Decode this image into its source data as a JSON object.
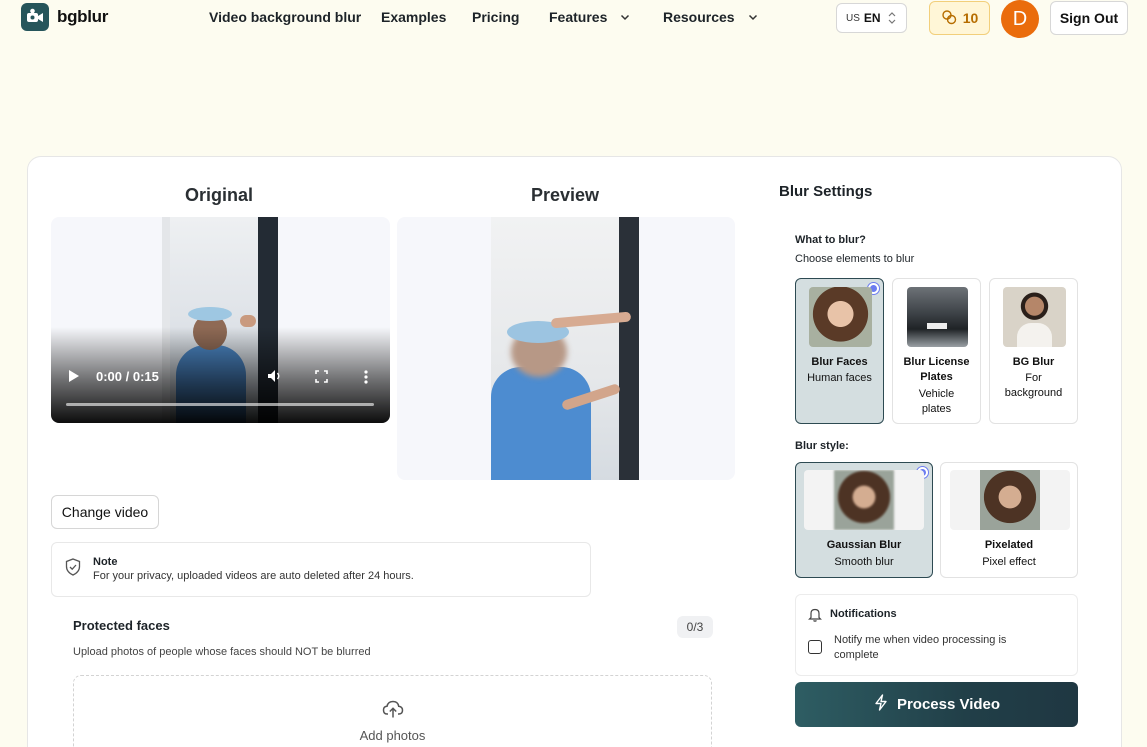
{
  "header": {
    "brand": "bgblur",
    "nav": [
      {
        "label": "Video background blur"
      },
      {
        "label": "Examples"
      },
      {
        "label": "Pricing"
      },
      {
        "label": "Features"
      },
      {
        "label": "Resources"
      }
    ],
    "lang_country": "US",
    "lang_code": "EN",
    "credits": "10",
    "avatar_letter": "D",
    "signout": "Sign Out"
  },
  "editor": {
    "original_title": "Original",
    "preview_title": "Preview",
    "player_time": "0:00 / 0:15",
    "change_video": "Change video",
    "note_title": "Note",
    "note_text": "For your privacy, uploaded videos are auto deleted after 24 hours.",
    "protected_title": "Protected faces",
    "protected_count": "0/3",
    "protected_sub": "Upload photos of people whose faces should NOT be blurred",
    "add_photos": "Add photos"
  },
  "settings": {
    "title": "Blur Settings",
    "what_label": "What to blur?",
    "what_sub": "Choose elements to blur",
    "targets": [
      {
        "title": "Blur Faces",
        "sub": "Human faces",
        "selected": true
      },
      {
        "title": "Blur License Plates",
        "sub": "Vehicle plates",
        "selected": false
      },
      {
        "title": "BG Blur",
        "sub": "For background",
        "selected": false
      }
    ],
    "style_label": "Blur style:",
    "styles": [
      {
        "title": "Gaussian Blur",
        "sub": "Smooth blur",
        "selected": true
      },
      {
        "title": "Pixelated",
        "sub": "Pixel effect",
        "selected": false
      }
    ],
    "notif_title": "Notifications",
    "notif_text": "Notify me when video processing is complete",
    "notif_checked": false,
    "process": "Process Video"
  },
  "colors": {
    "page_bg": "#fdfcf0",
    "brand": "#26555b",
    "accent_selected": "#d4dee0",
    "avatar": "#ea6c0c",
    "credits": "#b66d00",
    "radio_dot": "#6c7cf0"
  }
}
